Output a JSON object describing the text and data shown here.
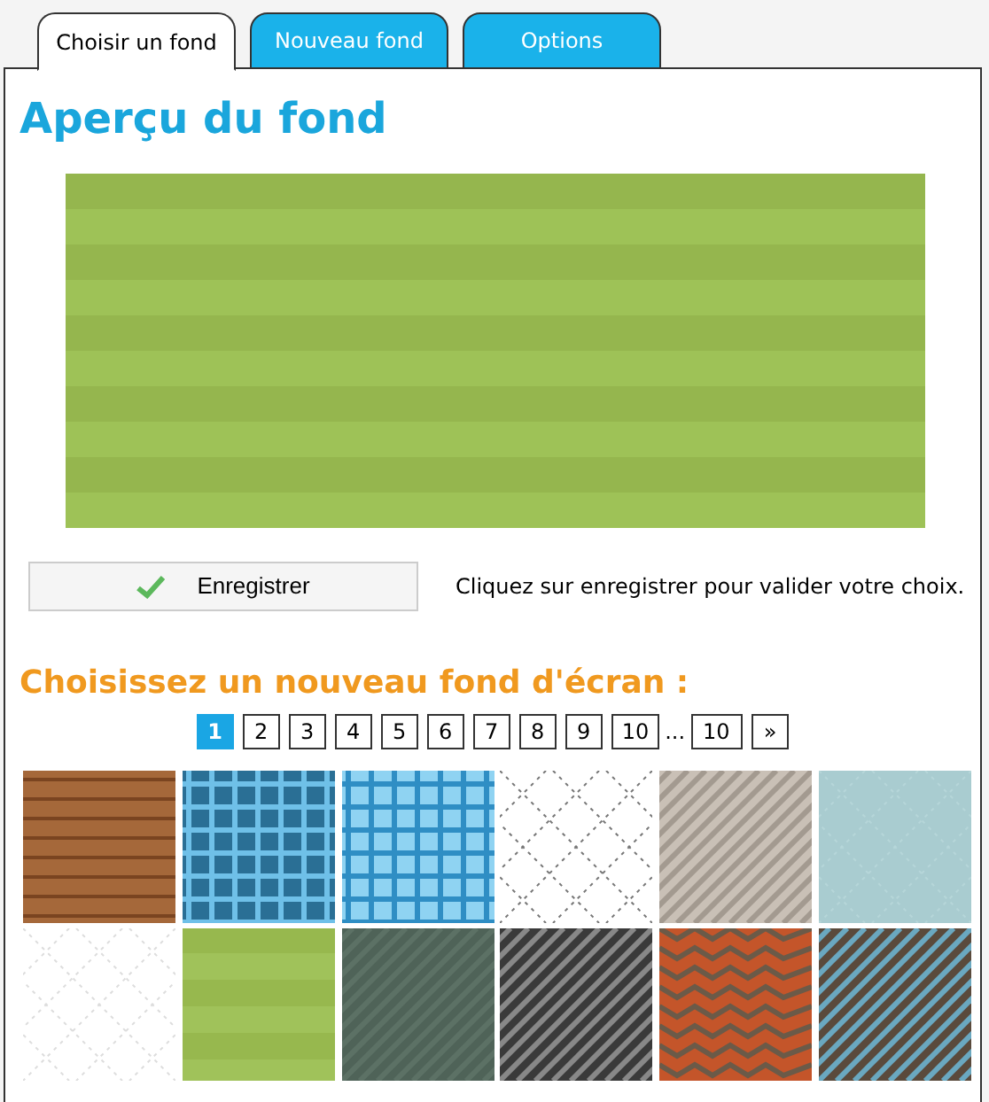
{
  "tabs": [
    {
      "label": "Choisir un fond",
      "selected": true
    },
    {
      "label": "Nouveau fond",
      "selected": false
    },
    {
      "label": "Options",
      "selected": false
    }
  ],
  "preview": {
    "title": "Aperçu du fond",
    "kind": "picture"
  },
  "save": {
    "label": "Enregistrer",
    "hint": "Cliquez sur enregistrer pour valider votre choix."
  },
  "gallery": {
    "title": "Choisissez un nouveau fond d'écran :",
    "pagination": {
      "pages": [
        {
          "label": "1",
          "selected": true
        },
        {
          "label": "2",
          "selected": false
        },
        {
          "label": "3",
          "selected": false
        },
        {
          "label": "4",
          "selected": false
        },
        {
          "label": "5",
          "selected": false
        },
        {
          "label": "6",
          "selected": false
        },
        {
          "label": "7",
          "selected": false
        },
        {
          "label": "8",
          "selected": false
        },
        {
          "label": "9",
          "selected": false
        },
        {
          "label": "10",
          "selected": false
        }
      ],
      "ellipsis": "...",
      "last": "10",
      "next": "»"
    }
  }
}
